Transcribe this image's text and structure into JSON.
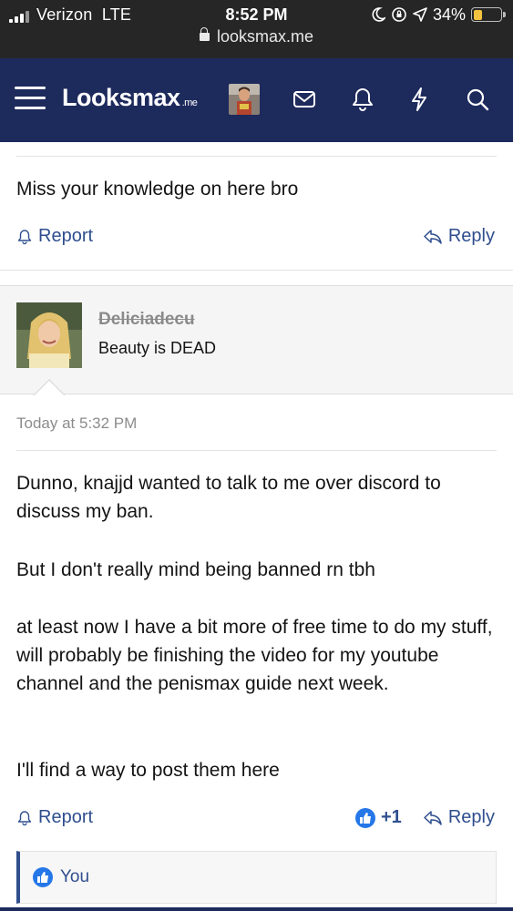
{
  "status_bar": {
    "carrier": "Verizon",
    "network": "LTE",
    "time": "8:52 PM",
    "battery": "34%",
    "battery_level": 0.34,
    "url": "looksmax.me"
  },
  "navbar": {
    "logo_main": "Looksmax",
    "logo_tld": ".me"
  },
  "post_previous": {
    "message": "Miss your knowledge on here bro",
    "report_label": "Report",
    "reply_label": "Reply"
  },
  "post": {
    "username": "Deliciadecu",
    "user_title": "Beauty is DEAD",
    "timestamp": "Today at 5:32 PM",
    "paragraphs": [
      "Dunno, knajjd wanted to talk to me over discord to discuss my ban.",
      "But I don't really mind being banned rn tbh",
      "at least now I have a bit more of free time to do my stuff, will probably be finishing the video for my youtube channel and the penismax guide next week.",
      "I'll find a way to post them here"
    ],
    "report_label": "Report",
    "like_count": "+1",
    "reply_label": "Reply",
    "likes_by": "You"
  },
  "colors": {
    "navbar": "#1d2a5c",
    "link": "#2f4e8e",
    "like_blue": "#2577e8"
  }
}
